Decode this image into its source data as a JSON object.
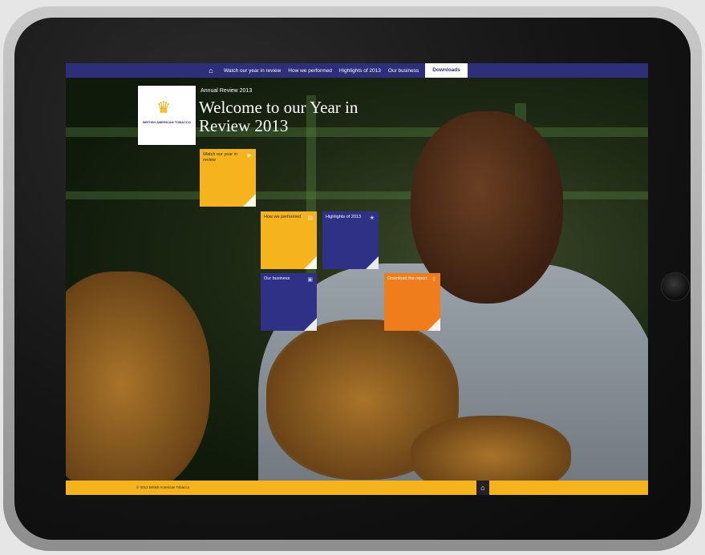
{
  "nav": {
    "items": [
      "Watch our year in review",
      "How we performed",
      "Highlights of 2013",
      "Our business"
    ],
    "downloads_label": "Downloads"
  },
  "brand": {
    "logo_text": "BRITISH AMERICAN TOBACCO"
  },
  "hero": {
    "eyebrow": "Annual Review 2013",
    "headline": "Welcome to our Year in Review 2013"
  },
  "tiles": [
    {
      "label": "Watch our year in review",
      "color": "#f5b41e"
    },
    {
      "label": "How we performed",
      "color": "#f5b41e"
    },
    {
      "label": "Highlights of 2013",
      "color": "#2f3187"
    },
    {
      "label": "Our business",
      "color": "#2f3187"
    },
    {
      "label": "Download the report",
      "color": "#f07d1c"
    }
  ],
  "footer": {
    "copyright": "© 2013 British American Tobacco"
  },
  "colors": {
    "nav": "#2e2f7a",
    "accent_yellow": "#f5b41e",
    "accent_orange": "#f07d1c"
  }
}
